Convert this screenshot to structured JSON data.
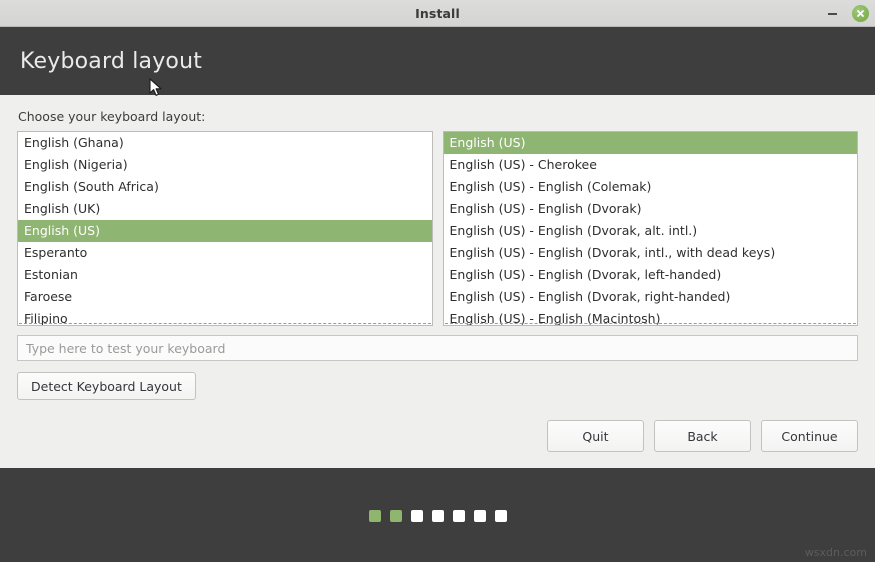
{
  "window": {
    "title": "Install",
    "minimize_label": "Minimize",
    "close_label": "Close"
  },
  "header": {
    "title": "Keyboard layout"
  },
  "main": {
    "choose_label": "Choose your keyboard layout:",
    "layout_list": [
      {
        "label": "English (Ghana)",
        "selected": false
      },
      {
        "label": "English (Nigeria)",
        "selected": false
      },
      {
        "label": "English (South Africa)",
        "selected": false
      },
      {
        "label": "English (UK)",
        "selected": false
      },
      {
        "label": "English (US)",
        "selected": true
      },
      {
        "label": "Esperanto",
        "selected": false
      },
      {
        "label": "Estonian",
        "selected": false
      },
      {
        "label": "Faroese",
        "selected": false
      },
      {
        "label": "Filipino",
        "selected": false
      }
    ],
    "variant_list": [
      {
        "label": "English (US)",
        "selected": true
      },
      {
        "label": "English (US) - Cherokee",
        "selected": false
      },
      {
        "label": "English (US) - English (Colemak)",
        "selected": false
      },
      {
        "label": "English (US) - English (Dvorak)",
        "selected": false
      },
      {
        "label": "English (US) - English (Dvorak, alt. intl.)",
        "selected": false
      },
      {
        "label": "English (US) - English (Dvorak, intl., with dead keys)",
        "selected": false
      },
      {
        "label": "English (US) - English (Dvorak, left-handed)",
        "selected": false
      },
      {
        "label": "English (US) - English (Dvorak, right-handed)",
        "selected": false
      },
      {
        "label": "English (US) - English (Macintosh)",
        "selected": false
      }
    ],
    "test_input": {
      "value": "",
      "placeholder": "Type here to test your keyboard"
    },
    "detect_button": "Detect Keyboard Layout"
  },
  "nav": {
    "quit": "Quit",
    "back": "Back",
    "continue": "Continue"
  },
  "footer": {
    "steps": [
      {
        "state": "done"
      },
      {
        "state": "done"
      },
      {
        "state": "todo"
      },
      {
        "state": "todo"
      },
      {
        "state": "todo"
      },
      {
        "state": "todo"
      },
      {
        "state": "todo"
      }
    ],
    "watermark": "wsxdn.com"
  },
  "colors": {
    "accent_green": "#8fb572",
    "header_dark": "#3e3e3e",
    "body_bg": "#efefee",
    "titlebar": "#d6d6d4"
  }
}
